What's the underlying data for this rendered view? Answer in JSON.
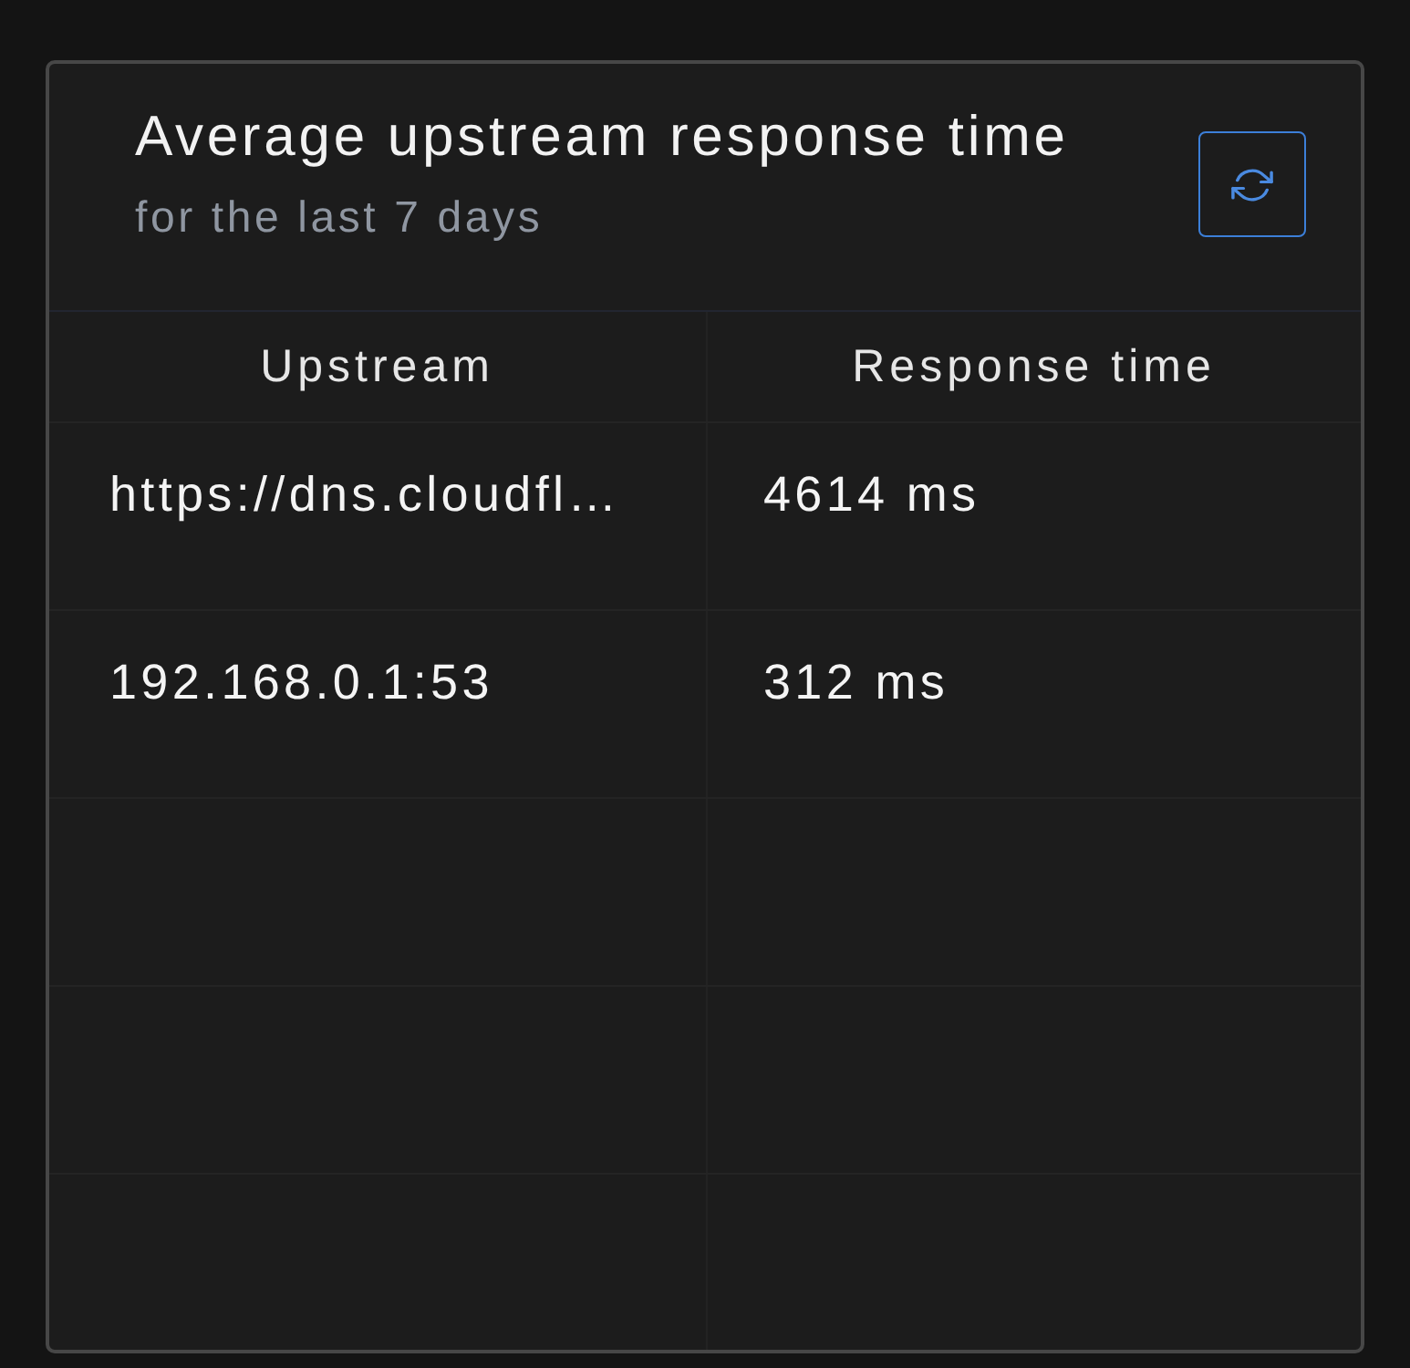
{
  "card": {
    "title": "Average upstream response time",
    "subtitle": "for the last 7 days"
  },
  "table": {
    "columns": [
      "Upstream",
      "Response time"
    ],
    "rows": [
      {
        "upstream": "https://dns.cloudfl…",
        "response_time": "4614 ms"
      },
      {
        "upstream": "192.168.0.1:53",
        "response_time": "312 ms"
      }
    ]
  }
}
